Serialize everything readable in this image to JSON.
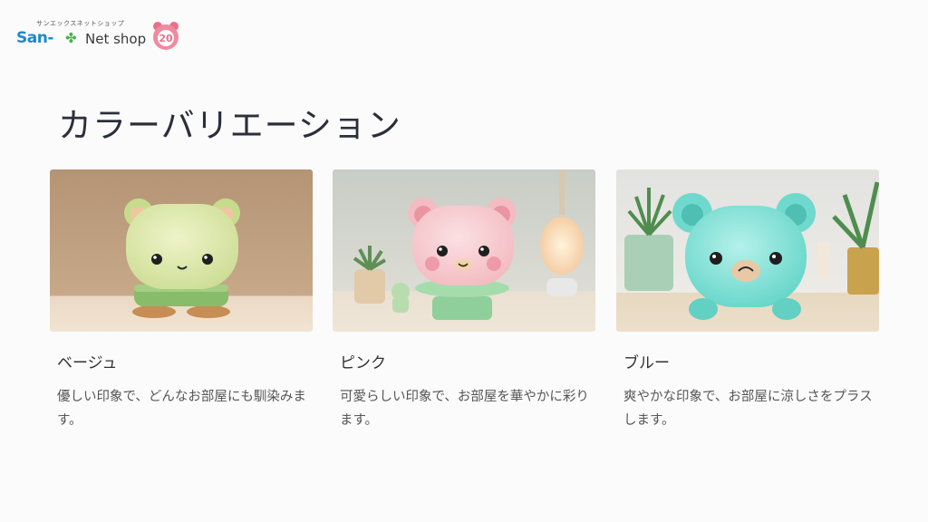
{
  "logo": {
    "kana": "サンエックスネットショップ",
    "brand": "San-",
    "clover": "✤",
    "shop": "Net shop",
    "badge": "20"
  },
  "heading": "カラーバリエーション",
  "cards": [
    {
      "title": "ベージュ",
      "desc": "優しい印象で、どんなお部屋にも馴染みます。",
      "color": "#d9e8a8"
    },
    {
      "title": "ピンク",
      "desc": "可愛らしい印象で、お部屋を華やかに彩ります。",
      "color": "#f6c6cc"
    },
    {
      "title": "ブルー",
      "desc": "爽やかな印象で、お部屋に涼しさをプラスします。",
      "color": "#7fe0d6"
    }
  ]
}
